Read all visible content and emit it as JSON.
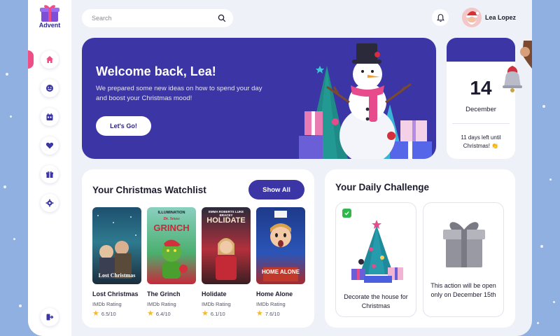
{
  "app": {
    "brand": "Advent"
  },
  "search": {
    "placeholder": "Search"
  },
  "user": {
    "name": "Lea Lopez"
  },
  "nav": {
    "items": [
      {
        "icon": "home-icon",
        "active": true
      },
      {
        "icon": "smile-icon"
      },
      {
        "icon": "calendar-icon"
      },
      {
        "icon": "heart-icon"
      },
      {
        "icon": "gift-icon"
      },
      {
        "icon": "gear-icon"
      }
    ],
    "logout_icon": "logout-icon"
  },
  "hero": {
    "title": "Welcome back, Lea!",
    "subtitle": "We prepared some new ideas on how to spend your day and boost your Christmas mood!",
    "button": "Let's Go!"
  },
  "calendar": {
    "day": "14",
    "month": "December",
    "note": "11 days left until Christmas! 👏"
  },
  "watchlist": {
    "title": "Your Christmas Watchlist",
    "show_all": "Show All",
    "movies": [
      {
        "title": "Lost Christmas",
        "rating_label": "IMDb Rating",
        "score": "6.5/10",
        "poster_text": "Lost Christmas"
      },
      {
        "title": "The Grinch",
        "rating_label": "IMDb Rating",
        "score": "6.4/10",
        "poster_text": "GRINCH",
        "poster_top": "ILLUMINATION",
        "poster_sub": "Dr. Seuss"
      },
      {
        "title": "Holidate",
        "rating_label": "IMDb Rating",
        "score": "6.1/10",
        "poster_text": "HOLIDATE",
        "poster_top": "EMMA ROBERTS   LUKE BRACEY"
      },
      {
        "title": "Home Alone",
        "rating_label": "IMDb Rating",
        "score": "7.6/10",
        "poster_text": "HOME ALONE"
      }
    ]
  },
  "challenge": {
    "title": "Your Daily Challenge",
    "cards": [
      {
        "text": "Decorate the house for Christmas",
        "done": true
      },
      {
        "text": "This action will be open only on December 15th",
        "locked": true
      }
    ]
  },
  "colors": {
    "primary": "#3c35a6",
    "accent": "#ee4d86",
    "background": "#8fb0e0",
    "star": "#f5b82e"
  }
}
